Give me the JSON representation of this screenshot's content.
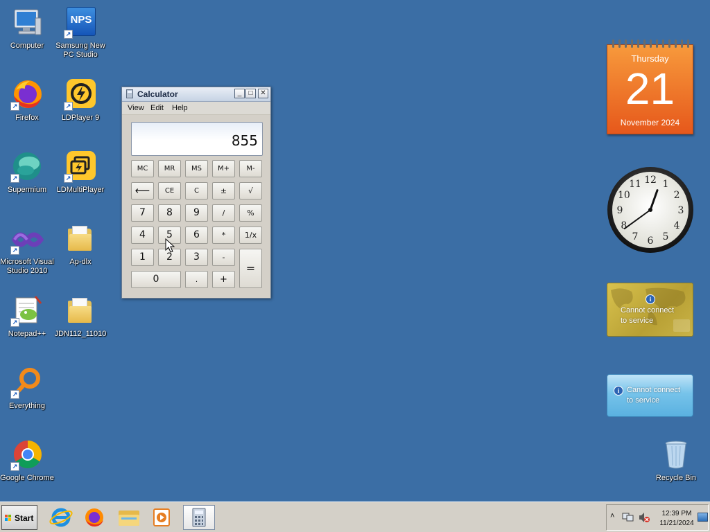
{
  "desktop": {
    "icons": [
      {
        "label_line1": "Computer",
        "label_line2": ""
      },
      {
        "label_line1": "Samsung New",
        "label_line2": "PC Studio",
        "badge": "NPS"
      },
      {
        "label_line1": "Firefox",
        "label_line2": ""
      },
      {
        "label_line1": "LDPlayer 9",
        "label_line2": ""
      },
      {
        "label_line1": "Supermium",
        "label_line2": ""
      },
      {
        "label_line1": "LDMultiPlayer",
        "label_line2": ""
      },
      {
        "label_line1": "Microsoft Visual",
        "label_line2": "Studio 2010"
      },
      {
        "label_line1": "Ap-dlx",
        "label_line2": ""
      },
      {
        "label_line1": "Notepad++",
        "label_line2": ""
      },
      {
        "label_line1": "JDN112_11010",
        "label_line2": ""
      },
      {
        "label_line1": "Everything",
        "label_line2": ""
      },
      {
        "label_line1": "Google Chrome",
        "label_line2": ""
      },
      {
        "label_line1": "Recycle Bin",
        "label_line2": ""
      }
    ],
    "background_color": "#3b6ea5"
  },
  "calculator": {
    "title": "Calculator",
    "menu": [
      "View",
      "Edit",
      "Help"
    ],
    "window_buttons": {
      "minimize": "_",
      "maximize": "□",
      "close": "✕"
    },
    "display_value": "855",
    "buttons": {
      "mc": "MC",
      "mr": "MR",
      "ms": "MS",
      "mplus": "M+",
      "mminus": "M-",
      "back": "⟵",
      "ce": "CE",
      "c": "C",
      "plusminus": "±",
      "sqrt": "√",
      "n7": "7",
      "n8": "8",
      "n9": "9",
      "div": "/",
      "pct": "%",
      "n4": "4",
      "n5": "5",
      "n6": "6",
      "mul": "*",
      "recip": "1/x",
      "n1": "1",
      "n2": "2",
      "n3": "3",
      "sub": "-",
      "eq": "=",
      "n0": "0",
      "dot": ".",
      "add": "+"
    }
  },
  "calendar_gadget": {
    "weekday": "Thursday",
    "day": "21",
    "month_year": "November 2024"
  },
  "clock_gadget": {
    "numerals": [
      "12",
      "1",
      "2",
      "3",
      "4",
      "5",
      "6",
      "7",
      "8",
      "9",
      "10",
      "11"
    ],
    "hour": 12,
    "minute": 39
  },
  "weather_gadget": {
    "line1": "Cannot connect",
    "line2": "to service",
    "info_icon": "i"
  },
  "currency_gadget": {
    "line1": "Cannot connect",
    "line2": "to service",
    "info_icon": "i"
  },
  "taskbar": {
    "start_label": "Start",
    "clock_time": "12:39 PM",
    "clock_date": "11/21/2024",
    "tray_chevron": "˄",
    "pinned": [
      "internet-explorer-icon",
      "firefox-icon",
      "file-explorer-icon",
      "media-player-icon",
      "calculator-icon"
    ]
  }
}
